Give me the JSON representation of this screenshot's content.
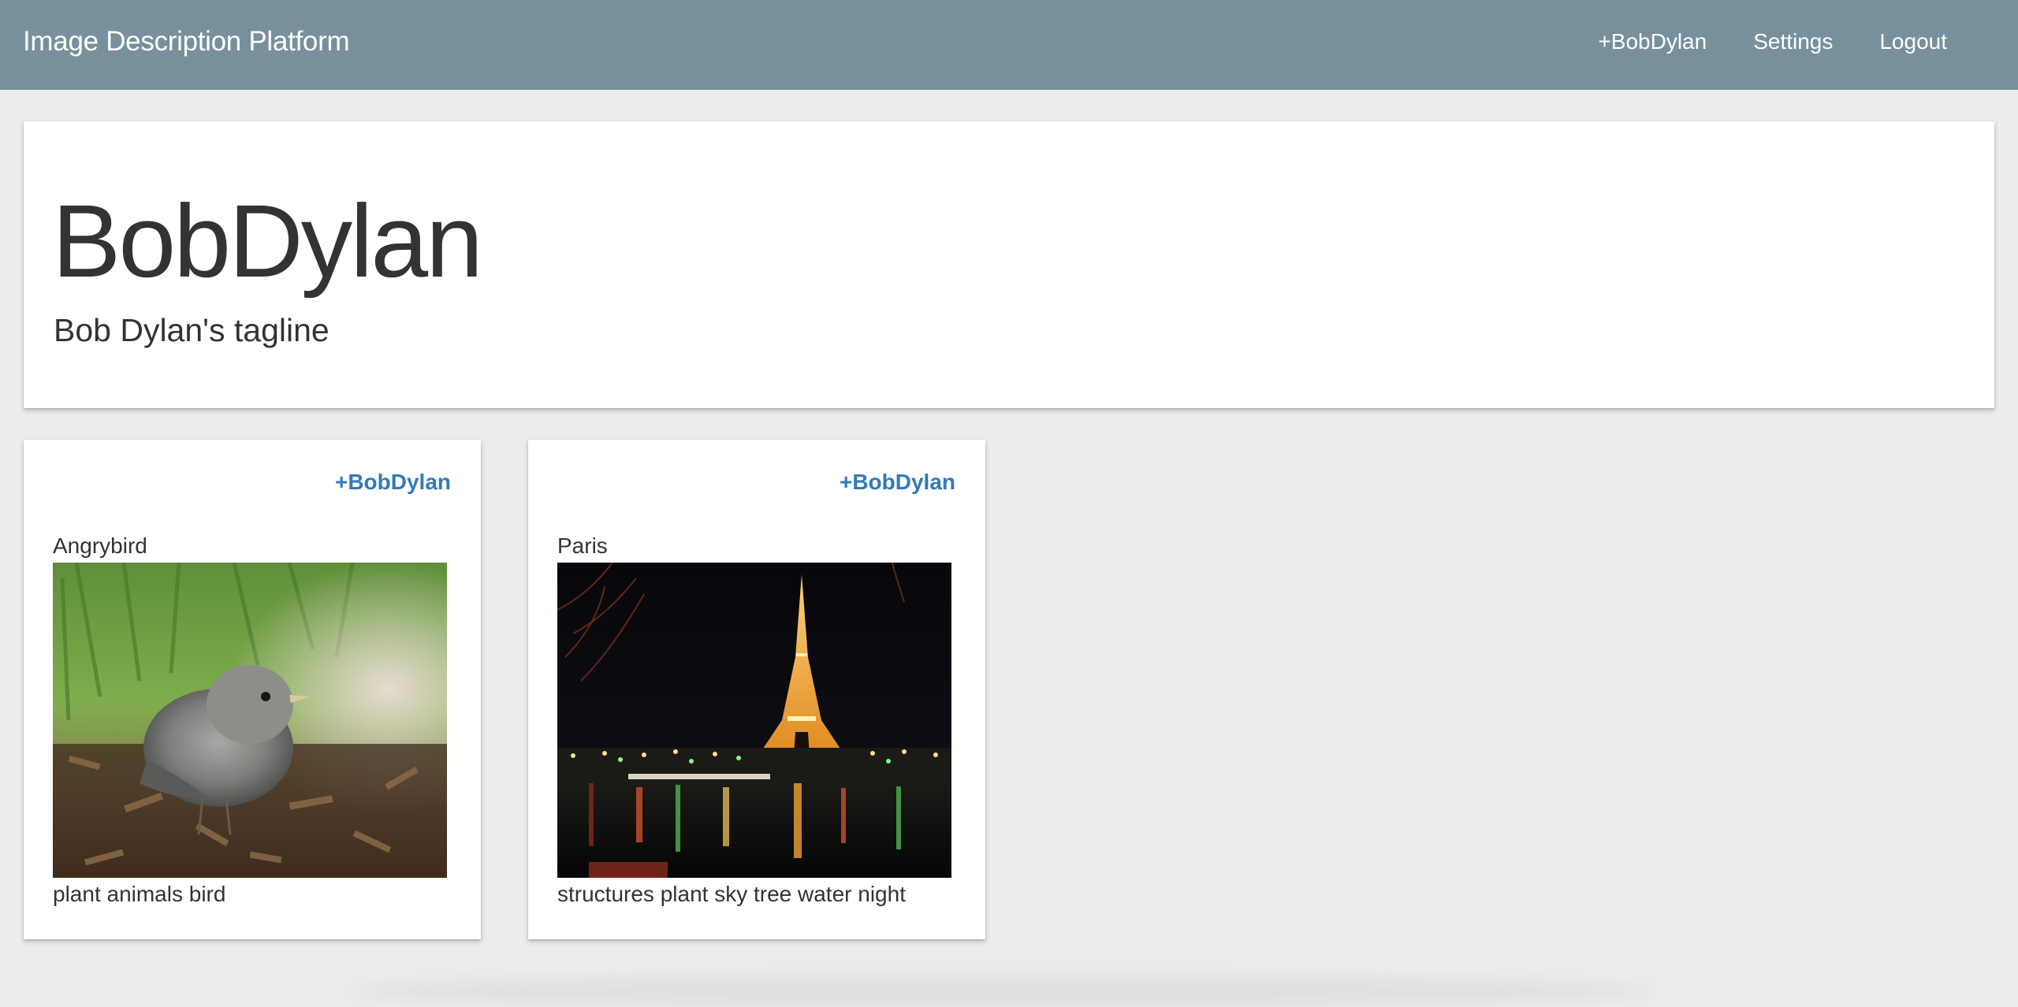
{
  "navbar": {
    "brand": "Image Description Platform",
    "links": [
      {
        "label": "+BobDylan"
      },
      {
        "label": "Settings"
      },
      {
        "label": "Logout"
      }
    ],
    "background_color": "#78909c"
  },
  "profile": {
    "name": "BobDylan",
    "tagline": "Bob Dylan's tagline"
  },
  "cards": [
    {
      "author": "+BobDylan",
      "title": "Angrybird",
      "image_subject": "young-bird-photo",
      "tags": "plant animals bird"
    },
    {
      "author": "+BobDylan",
      "title": "Paris",
      "image_subject": "eiffel-tower-night-photo",
      "tags": "structures plant sky tree water night"
    }
  ],
  "colors": {
    "page_background": "#ececec",
    "link_blue": "#337ab7"
  }
}
